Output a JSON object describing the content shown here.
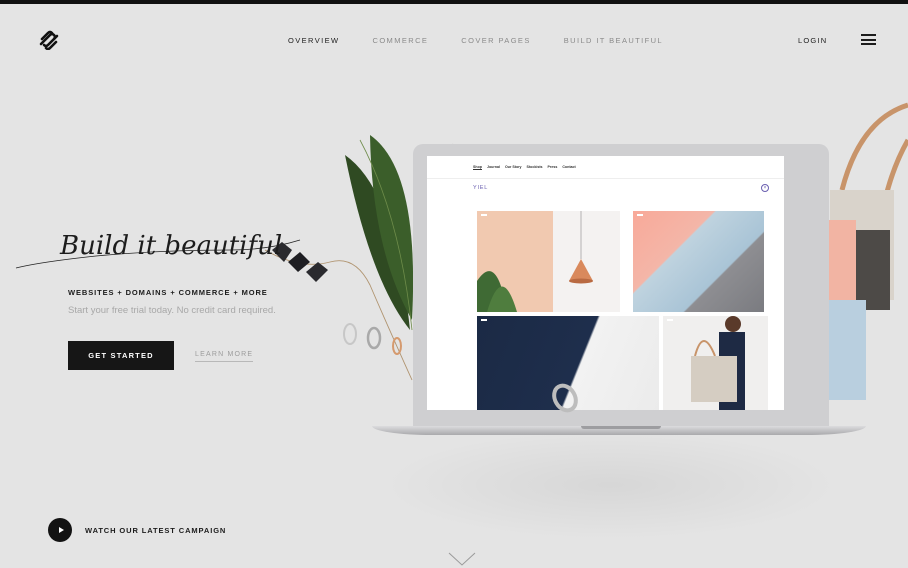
{
  "header": {
    "nav": [
      {
        "label": "OVERVIEW",
        "active": true
      },
      {
        "label": "COMMERCE",
        "active": false
      },
      {
        "label": "COVER PAGES",
        "active": false
      },
      {
        "label": "BUILD IT BEAUTIFUL",
        "active": false
      }
    ],
    "login_label": "LOGIN",
    "logo_icon": "squarespace-logo-icon",
    "menu_icon": "hamburger-menu-icon"
  },
  "hero": {
    "script_text": "Build it beautiful",
    "tagline": "WEBSITES + DOMAINS + COMMERCE + MORE",
    "subline": "Start your free trial today. No credit card required.",
    "cta_primary": "GET STARTED",
    "cta_secondary": "LEARN MORE"
  },
  "campaign": {
    "label": "WATCH OUR LATEST CAMPAIGN",
    "icon": "play-icon"
  },
  "laptop_site": {
    "nav": [
      "Shop",
      "Journal",
      "Our Story",
      "Stockists",
      "Press",
      "Contact"
    ],
    "brand": "YIEL"
  },
  "colors": {
    "background": "#e4e4e4",
    "primary_button": "#161616",
    "text": "#1c1c1c",
    "muted_text": "#a8a8a8",
    "accent_brand": "#6a5fb0"
  }
}
